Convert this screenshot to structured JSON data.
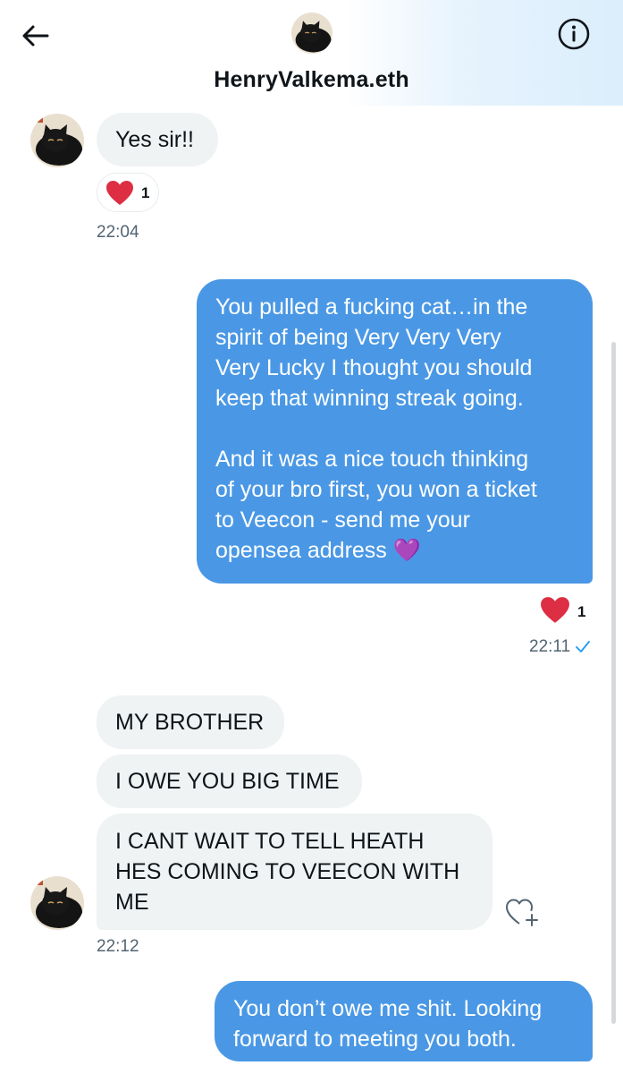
{
  "header": {
    "contact_name": "HenryValkema.eth",
    "back_icon": "arrow-left-icon",
    "info_icon": "info-icon"
  },
  "messages": [
    {
      "id": "m1",
      "direction": "incoming",
      "text": "Yes sir!!",
      "reaction": {
        "emoji": "❤️",
        "count": "1"
      },
      "time": "22:04"
    },
    {
      "id": "m2",
      "direction": "outgoing",
      "lines": [
        "You pulled a fucking cat…in the",
        "spirit of being Very Very Very",
        "Very Lucky I thought you should",
        "keep that winning streak going.",
        "",
        "And it was a nice touch thinking",
        "of your bro first, you won a ticket",
        "to Veecon - send me your",
        "opensea address 💜"
      ],
      "reaction": {
        "emoji": "❤️",
        "count": "1"
      },
      "time": "22:11",
      "read_icon": "checkmark-icon"
    },
    {
      "id": "m3",
      "direction": "incoming",
      "text": "MY BROTHER"
    },
    {
      "id": "m4",
      "direction": "incoming",
      "text": "I OWE YOU BIG TIME"
    },
    {
      "id": "m5",
      "direction": "incoming",
      "lines": [
        "I CANT WAIT TO TELL HEATH",
        "HES COMING TO VEECON WITH",
        "ME"
      ],
      "time": "22:12",
      "react_icon": "add-reaction-heart-icon"
    },
    {
      "id": "m6",
      "direction": "outgoing",
      "lines": [
        "You don’t owe me shit. Looking",
        "forward to meeting you both."
      ]
    }
  ],
  "colors": {
    "outgoing_bubble": "#4a98e5",
    "incoming_bubble": "#eff3f4",
    "heart": "#dd2e44"
  }
}
